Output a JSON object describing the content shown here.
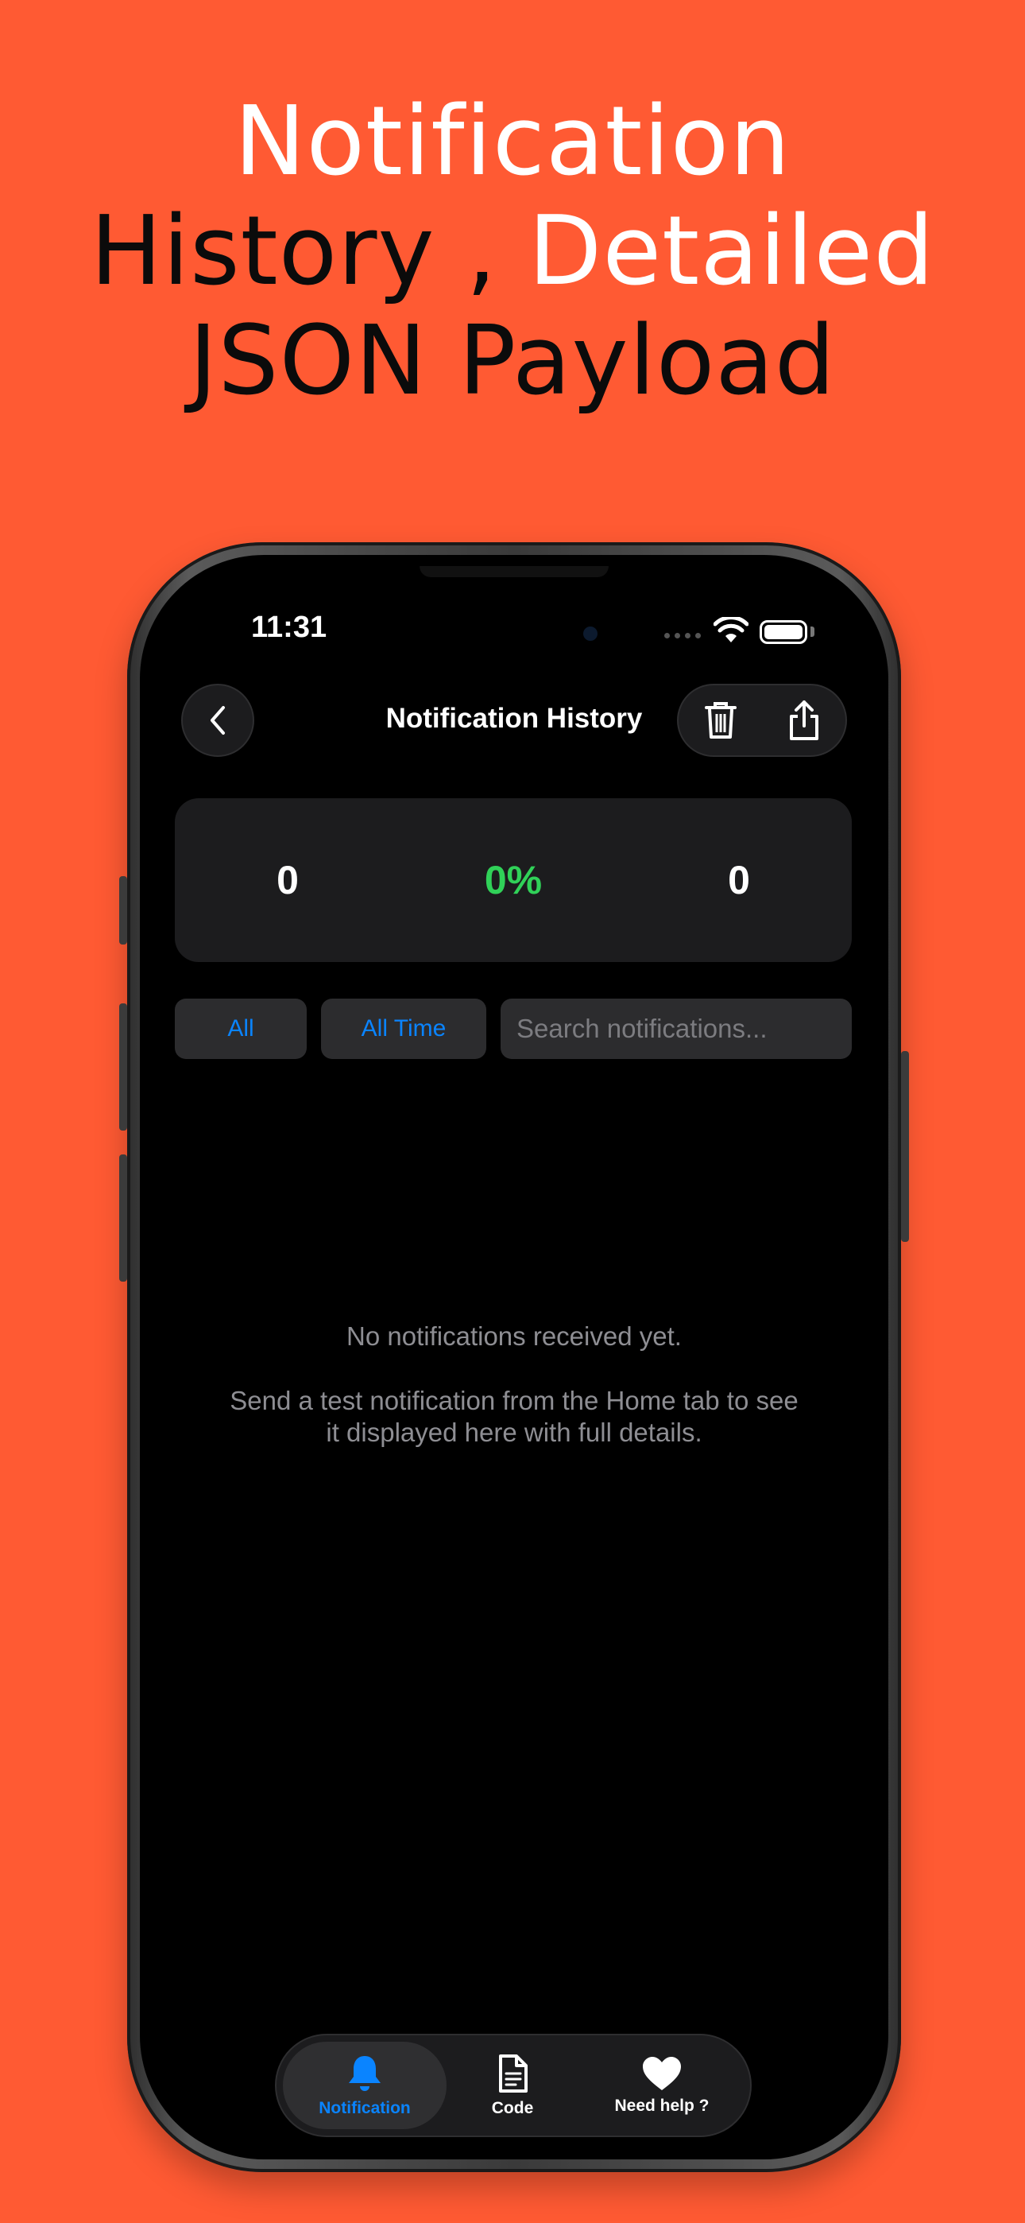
{
  "headline": {
    "line1": "Notification",
    "line2_part1": "History , ",
    "line2_part2": "Detailed",
    "line3": "JSON Payload"
  },
  "status_bar": {
    "time": "11:31"
  },
  "nav": {
    "title": "Notification History"
  },
  "stats": {
    "left": "0",
    "center": "0%",
    "right": "0"
  },
  "filters": {
    "type_label": "All",
    "time_label": "All Time",
    "search_placeholder": "Search notifications..."
  },
  "empty_state": {
    "title": "No notifications received yet.",
    "description": "Send a test notification from the Home tab to see it displayed here with full details."
  },
  "tabs": [
    {
      "label": "Notification",
      "icon": "bell-icon"
    },
    {
      "label": "Code",
      "icon": "document-icon"
    },
    {
      "label": "Need help ?",
      "icon": "heart-icon"
    }
  ],
  "colors": {
    "background": "#FF5A33",
    "accent": "#0A84FF",
    "success": "#30D158"
  }
}
